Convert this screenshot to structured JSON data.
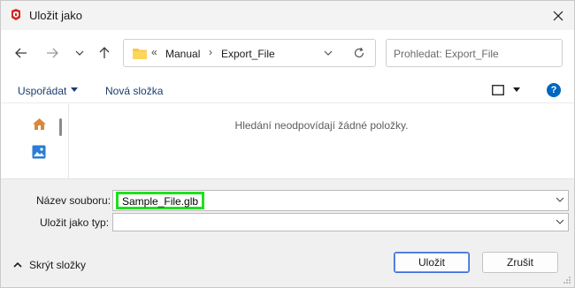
{
  "window": {
    "title": "Uložit jako",
    "app_icon": "sketchup-icon",
    "close_icon": "close-icon"
  },
  "navigation": {
    "back_icon": "arrow-left-icon",
    "forward_icon": "arrow-right-icon",
    "recent_icon": "chevron-down-icon",
    "up_icon": "arrow-up-icon",
    "address": {
      "overflow": "«",
      "segments": [
        "Manual",
        "Export_File"
      ],
      "separator": "›"
    },
    "search": {
      "placeholder": "Prohledat: Export_File"
    }
  },
  "commandbar": {
    "organize": "Uspořádat",
    "new_folder": "Nová složka",
    "help": "?"
  },
  "content": {
    "empty_message": "Hledání neodpovídají žádné položky."
  },
  "form": {
    "filename_label": "Název souboru:",
    "filename_value": "Sample_File.glb",
    "filetype_label": "Uložit jako typ:",
    "filetype_value": ""
  },
  "footer": {
    "hide_folders": "Skrýt složky",
    "save": "Uložit",
    "cancel": "Zrušit"
  },
  "colors": {
    "highlight": "#1ee01e",
    "accent": "#0067c0",
    "folder": "#f7c844"
  }
}
